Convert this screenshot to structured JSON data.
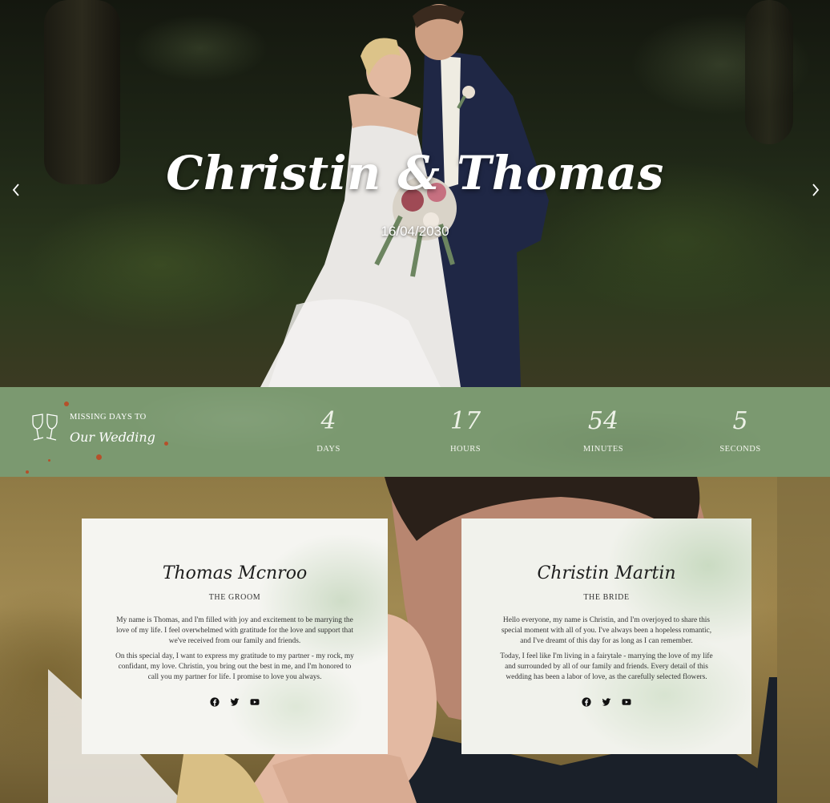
{
  "hero": {
    "title": "Christin & Thomas",
    "date": "16/04/2030",
    "prev_icon": "chevron-left-icon",
    "next_icon": "chevron-right-icon"
  },
  "countdown": {
    "label_top": "MISSING DAYS TO",
    "label_main": "Our Wedding",
    "icon": "champagne-glasses-icon",
    "items": [
      {
        "value": "4",
        "unit": "DAYS"
      },
      {
        "value": "17",
        "unit": "HOURS"
      },
      {
        "value": "54",
        "unit": "MINUTES"
      },
      {
        "value": "5",
        "unit": "SECONDS"
      }
    ]
  },
  "groom": {
    "name": "Thomas Mcnroo",
    "role": "THE GROOM",
    "paragraphs": [
      "My name is Thomas, and I'm filled with joy and excitement to be marrying the love of my life. I feel overwhelmed with gratitude for the love and support that we've received from our family and friends.",
      "On this special day, I want to express my gratitude to my partner - my rock, my confidant, my love. Christin, you bring out the best in me, and I'm honored to call you my partner for life. I promise to love you always."
    ],
    "socials": [
      "facebook-icon",
      "twitter-icon",
      "youtube-icon"
    ]
  },
  "bride": {
    "name": "Christin Martin",
    "role": "THE BRIDE",
    "paragraphs": [
      "Hello everyone, my name is Christin, and I'm overjoyed to share this special moment with all of you. I've always been a hopeless romantic, and I've dreamt of this day for as long as I can remember.",
      "Today, I feel like I'm living in a fairytale - marrying the love of my life and surrounded by all of our family and friends. Every detail of this wedding has been a labor of love, as the carefully selected flowers."
    ],
    "socials": [
      "facebook-icon",
      "twitter-icon",
      "youtube-icon"
    ]
  },
  "colors": {
    "countdown_bg": "#7b9970",
    "card_bg": "#f5f5f1",
    "accent_green": "#a8c49a"
  }
}
